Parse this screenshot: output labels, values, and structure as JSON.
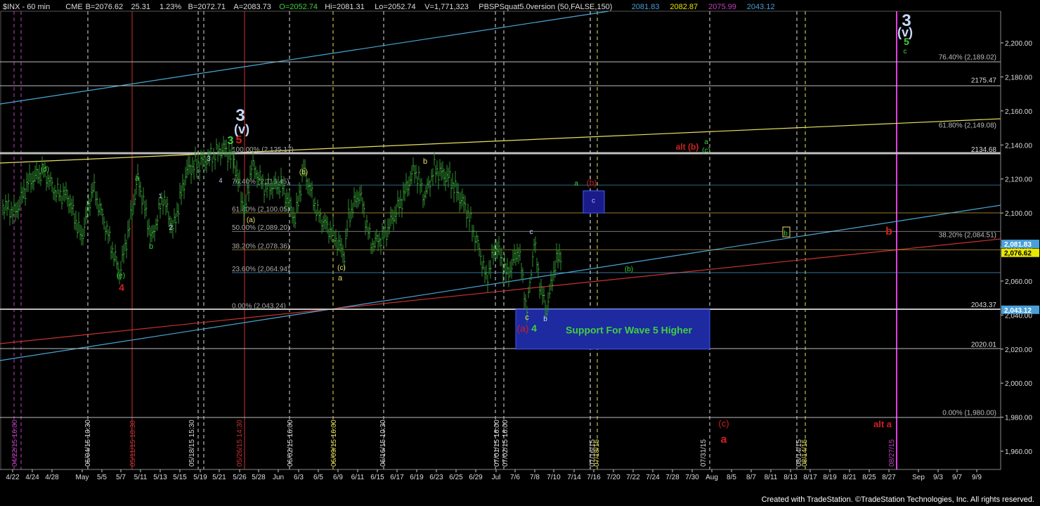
{
  "header": {
    "symbol": "$INX - 60 min",
    "exchange": "CME",
    "last": "B=2076.62",
    "change": "25.31",
    "change_pct": "1.23%",
    "bid": "B=2072.71",
    "ask": "A=2083.73",
    "open": "O=2052.74",
    "high": "Hi=2081.31",
    "low": "Lo=2052.74",
    "volume": "V=1,771,323",
    "study": "PBSPSquat5.0version (50,FALSE,150)",
    "study_values": [
      "2081.83",
      "2082.87",
      "2075.99",
      "2043.12"
    ],
    "study_colors": [
      "#4a9fd8",
      "#e8e800",
      "#c040c0",
      "#4a9fd8"
    ]
  },
  "footer": "Created with TradeStation. ©TradeStation Technologies, Inc. All rights reserved.",
  "colors": {
    "background": "#000000",
    "bars": "#2e8b2e",
    "channel": "#4aa8d8",
    "trend_red": "#c83232",
    "trend_yellow": "#e8e060",
    "fib": "#c8c8c8",
    "support_box": "#1e2aa0",
    "support_text": "#40d040",
    "magenta": "#e040e0"
  },
  "chart_data": {
    "type": "bar",
    "title": "$INX - 60 min",
    "y_axis": {
      "min": 1950,
      "max": 2225,
      "ticks": [
        1960,
        1980,
        2000,
        2020,
        2040,
        2060,
        2080,
        2100,
        2120,
        2140,
        2160,
        2180,
        2200
      ],
      "labels": [
        "1,960.00",
        "1,980.00",
        "2,000.00",
        "2,020.00",
        "2,040.00",
        "2,060.00",
        "2,080.00",
        "2,100.00",
        "2,120.00",
        "2,140.00",
        "2,160.00",
        "2,180.00",
        "2,200.00"
      ]
    },
    "x_ticks": [
      "4/22",
      "4/24",
      "4/28",
      "May",
      "5/5",
      "5/7",
      "5/11",
      "5/13",
      "5/15",
      "5/19",
      "5/21",
      "5/26",
      "5/28",
      "Jun",
      "6/3",
      "6/5",
      "6/9",
      "6/11",
      "6/15",
      "6/17",
      "6/19",
      "6/23",
      "6/25",
      "6/29",
      "Jul",
      "7/6",
      "7/8",
      "7/10",
      "7/14",
      "7/16",
      "7/20",
      "7/22",
      "7/24",
      "7/28",
      "7/30",
      "Aug",
      "8/5",
      "8/7",
      "8/11",
      "8/13",
      "8/17",
      "8/19",
      "8/21",
      "8/25",
      "8/27",
      "Sep",
      "9/3",
      "9/7",
      "9/9"
    ],
    "price_path": [
      [
        4,
        2105
      ],
      [
        22,
        2100
      ],
      [
        40,
        2118
      ],
      [
        62,
        2125
      ],
      [
        80,
        2112
      ],
      [
        96,
        2110
      ],
      [
        116,
        2085
      ],
      [
        132,
        2115
      ],
      [
        150,
        2093
      ],
      [
        170,
        2064
      ],
      [
        184,
        2092
      ],
      [
        196,
        2120
      ],
      [
        216,
        2085
      ],
      [
        232,
        2110
      ],
      [
        246,
        2090
      ],
      [
        266,
        2125
      ],
      [
        290,
        2131
      ],
      [
        318,
        2138
      ],
      [
        333,
        2131
      ],
      [
        348,
        2100
      ],
      [
        358,
        2128
      ],
      [
        378,
        2115
      ],
      [
        400,
        2117
      ],
      [
        420,
        2096
      ],
      [
        432,
        2126
      ],
      [
        452,
        2100
      ],
      [
        476,
        2086
      ],
      [
        490,
        2075
      ],
      [
        496,
        2098
      ],
      [
        512,
        2112
      ],
      [
        528,
        2082
      ],
      [
        546,
        2086
      ],
      [
        570,
        2106
      ],
      [
        590,
        2126
      ],
      [
        604,
        2110
      ],
      [
        618,
        2126
      ],
      [
        640,
        2120
      ],
      [
        664,
        2102
      ],
      [
        682,
        2079
      ],
      [
        692,
        2061
      ],
      [
        706,
        2081
      ],
      [
        722,
        2063
      ],
      [
        738,
        2079
      ],
      [
        750,
        2042
      ],
      [
        760,
        2083
      ],
      [
        770,
        2054
      ],
      [
        778,
        2043
      ],
      [
        790,
        2070
      ],
      [
        800,
        2077
      ]
    ],
    "fib_levels": [
      {
        "label": "100.00% (2,135.17)",
        "value": 2135.17
      },
      {
        "label": "76.40% (2,116.45)",
        "value": 2116.45
      },
      {
        "label": "61.80% (2,100.05)",
        "value": 2100.05
      },
      {
        "label": "50.00% (2,089.20)",
        "value": 2089.2
      },
      {
        "label": "38.20% (2,078.36)",
        "value": 2078.36
      },
      {
        "label": "23.60% (2,064.94)",
        "value": 2064.94
      },
      {
        "label": "0.00% (2,043.24)",
        "value": 2043.24
      }
    ],
    "right_fib_labels": [
      {
        "label": "76.40% (2,189.02)",
        "value": 2189.02
      },
      {
        "label": "61.80% (2,149.08)",
        "value": 2149.08
      },
      {
        "label": "38.20% (2,084.51)",
        "value": 2084.51
      },
      {
        "label": "0.00% (1,980.00)",
        "value": 1980.0
      }
    ],
    "level_labels": [
      {
        "label": "2175.47",
        "value": 2175.47
      },
      {
        "label": "2134.68",
        "value": 2134.68
      },
      {
        "label": "2043.37",
        "value": 2043.37
      },
      {
        "label": "2020.01",
        "value": 2020.01
      }
    ],
    "price_tags": [
      {
        "label": "2,081.83",
        "value": 2081.83
      },
      {
        "label": "2,076.62",
        "value": 2076.62
      },
      {
        "label": "2,043.12",
        "value": 2043.12
      }
    ],
    "support_box": {
      "label": "Support For Wave 5 Higher",
      "low": 2020.01,
      "high": 2043.37
    },
    "target_box": {
      "label": "c",
      "low": 2100,
      "high": 2113
    },
    "vertical_dates": [
      "04/22/15 16:00",
      "05/04/15 10:30",
      "05/11/15 10:30",
      "05/18/15 15:30",
      "05/26/15 14:30",
      "06/02/15 16:00",
      "06/09/15 16:00",
      "06/16/15 10:30",
      "07/01/15 16:00",
      "07/02/15 16:00",
      "07/16/15",
      "07/18/15",
      "07/31/15",
      "08/14/15",
      "08/14/15",
      "08/27/15"
    ],
    "wave_labels": [
      "4",
      "3",
      "5",
      "3",
      "(v)",
      "(d)",
      "(e)",
      "a",
      "b",
      "2",
      "3",
      "4",
      "1",
      "(a)",
      "(b)",
      "(c)",
      "a",
      "b",
      "c",
      "(a)",
      "4",
      "c",
      "b",
      "a",
      "(a)",
      "(b)",
      "c",
      "(b)",
      "alt (b)",
      "a",
      "(c)",
      "b",
      "b",
      "(c)",
      "a",
      "alt a",
      "3",
      "(v)",
      "5",
      "c"
    ]
  }
}
